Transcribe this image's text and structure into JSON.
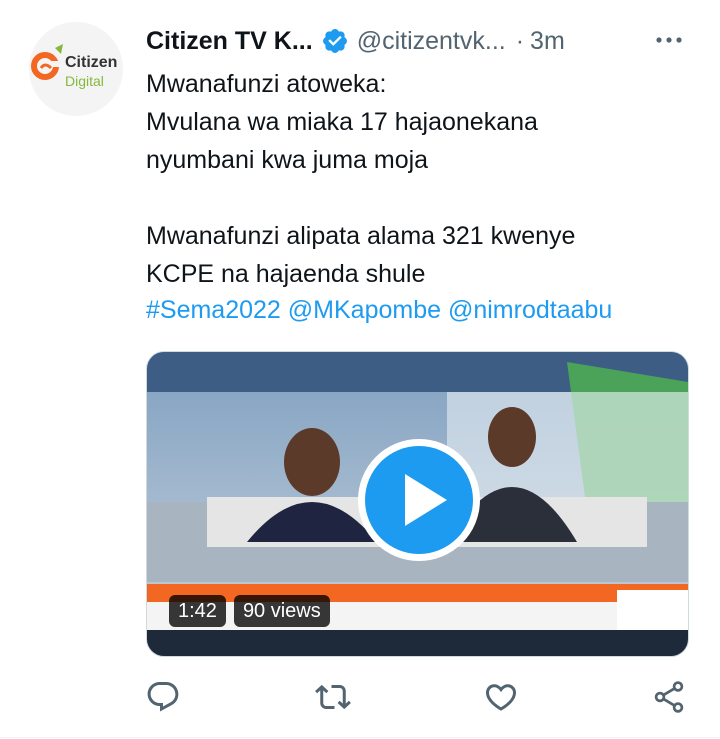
{
  "author": {
    "name": "Citizen TV K...",
    "handle": "@citizentvk...",
    "separator": "·",
    "time": "3m",
    "avatar_text_line1": "Citizen",
    "avatar_text_line2": "Digital"
  },
  "tweet": {
    "text": "Mwanafunzi atoweka:\nMvulana wa miaka 17 hajaonekana\nnyumbani kwa juma moja\n\nMwanafunzi alipata alama 321 kwenye\nKCPE na hajaenda shule",
    "hashtag": "#Sema2022",
    "mention1": "@MKapombe",
    "mention2": "@nimrodtaabu"
  },
  "video": {
    "duration": "1:42",
    "views": "90 views"
  },
  "icons": {
    "verified": "verified-badge-icon",
    "more": "more-icon",
    "reply": "reply-icon",
    "retweet": "retweet-icon",
    "like": "like-icon",
    "share": "share-icon",
    "play": "play-icon"
  },
  "colors": {
    "accent": "#1d9bf0",
    "text": "#0f1419",
    "secondary": "#536471"
  }
}
